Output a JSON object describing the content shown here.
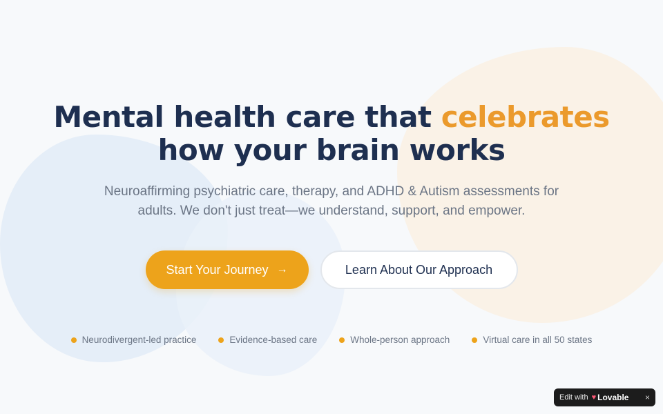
{
  "hero": {
    "headline_part1": "Mental health care that ",
    "headline_accent": "celebrates",
    "headline_part2": " how your brain works",
    "subheadline": "Neuroaffirming psychiatric care, therapy, and ADHD & Autism assessments for adults. We don't just treat—we understand, support, and empower."
  },
  "cta": {
    "primary_label": "Start Your Journey",
    "primary_icon": "→",
    "secondary_label": "Learn About Our Approach"
  },
  "features": [
    "Neurodivergent-led practice",
    "Evidence-based care",
    "Whole-person approach",
    "Virtual care in all 50 states"
  ],
  "badge": {
    "edit_text": "Edit with",
    "brand": "Lovable",
    "heart_icon": "heart-icon",
    "close_icon": "×"
  },
  "colors": {
    "headline": "#1e2f50",
    "accent": "#eb9a2c",
    "primary_button": "#eda31b",
    "body_text": "#6b7585"
  }
}
